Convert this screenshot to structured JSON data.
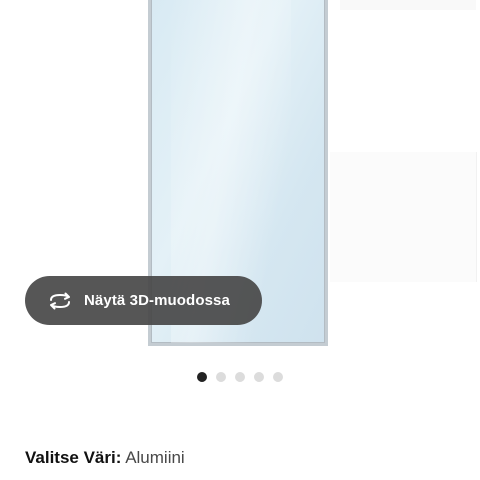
{
  "product_viewer": {
    "view_3d_button": {
      "label": "Näytä 3D-muodossa",
      "icon": "rotate-3d-icon"
    },
    "carousel": {
      "total_images": 5,
      "active_index": 0
    }
  },
  "color_selector": {
    "label": "Valitse Väri:",
    "value": "Alumiini"
  },
  "colors": {
    "button_bg": "#484848",
    "dot_active": "#222222",
    "dot_inactive": "#dcdcdc"
  }
}
